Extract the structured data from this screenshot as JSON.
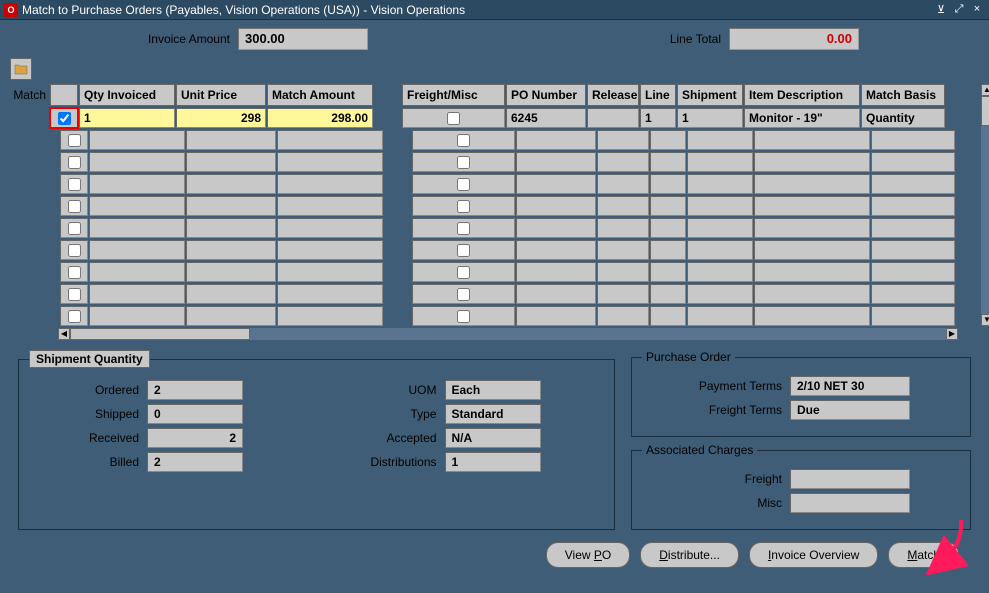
{
  "window": {
    "title": "Match to Purchase Orders (Payables, Vision Operations (USA)) - Vision Operations"
  },
  "header": {
    "invoice_amount_label": "Invoice Amount",
    "invoice_amount": "300.00",
    "line_total_label": "Line Total",
    "line_total": "0.00"
  },
  "grid": {
    "match_label": "Match",
    "columns": {
      "qty": "Qty Invoiced",
      "price": "Unit Price",
      "amt": "Match Amount",
      "fm": "Freight/Misc",
      "pon": "PO Number",
      "rel": "Release",
      "line": "Line",
      "ship": "Shipment",
      "desc": "Item Description",
      "basis": "Match Basis"
    },
    "rows": [
      {
        "checked": true,
        "qty": "1",
        "price": "298",
        "amt": "298.00",
        "fm": false,
        "pon": "6245",
        "rel": "",
        "line": "1",
        "ship": "1",
        "desc": "Monitor - 19\"",
        "basis": "Quantity",
        "active": true
      },
      {
        "checked": false,
        "qty": "",
        "price": "",
        "amt": "",
        "fm": false,
        "pon": "",
        "rel": "",
        "line": "",
        "ship": "",
        "desc": "",
        "basis": ""
      },
      {
        "checked": false,
        "qty": "",
        "price": "",
        "amt": "",
        "fm": false,
        "pon": "",
        "rel": "",
        "line": "",
        "ship": "",
        "desc": "",
        "basis": ""
      },
      {
        "checked": false,
        "qty": "",
        "price": "",
        "amt": "",
        "fm": false,
        "pon": "",
        "rel": "",
        "line": "",
        "ship": "",
        "desc": "",
        "basis": ""
      },
      {
        "checked": false,
        "qty": "",
        "price": "",
        "amt": "",
        "fm": false,
        "pon": "",
        "rel": "",
        "line": "",
        "ship": "",
        "desc": "",
        "basis": ""
      },
      {
        "checked": false,
        "qty": "",
        "price": "",
        "amt": "",
        "fm": false,
        "pon": "",
        "rel": "",
        "line": "",
        "ship": "",
        "desc": "",
        "basis": ""
      },
      {
        "checked": false,
        "qty": "",
        "price": "",
        "amt": "",
        "fm": false,
        "pon": "",
        "rel": "",
        "line": "",
        "ship": "",
        "desc": "",
        "basis": ""
      },
      {
        "checked": false,
        "qty": "",
        "price": "",
        "amt": "",
        "fm": false,
        "pon": "",
        "rel": "",
        "line": "",
        "ship": "",
        "desc": "",
        "basis": ""
      },
      {
        "checked": false,
        "qty": "",
        "price": "",
        "amt": "",
        "fm": false,
        "pon": "",
        "rel": "",
        "line": "",
        "ship": "",
        "desc": "",
        "basis": ""
      },
      {
        "checked": false,
        "qty": "",
        "price": "",
        "amt": "",
        "fm": false,
        "pon": "",
        "rel": "",
        "line": "",
        "ship": "",
        "desc": "",
        "basis": ""
      }
    ]
  },
  "shipment": {
    "legend": "Shipment Quantity",
    "ordered_label": "Ordered",
    "ordered": "2",
    "shipped_label": "Shipped",
    "shipped": "0",
    "received_label": "Received",
    "received": "2",
    "billed_label": "Billed",
    "billed": "2",
    "uom_label": "UOM",
    "uom": "Each",
    "type_label": "Type",
    "type": "Standard",
    "accepted_label": "Accepted",
    "accepted": "N/A",
    "dist_label": "Distributions",
    "dist": "1"
  },
  "po": {
    "legend": "Purchase Order",
    "terms_label": "Payment Terms",
    "terms": "2/10 NET 30",
    "freight_terms_label": "Freight Terms",
    "freight_terms": "Due",
    "assoc_legend": "Associated Charges",
    "freight_label": "Freight",
    "freight": "",
    "misc_label": "Misc",
    "misc": ""
  },
  "buttons": {
    "view_po": "View PO",
    "distribute": "Distribute...",
    "invoice_overview": "Invoice Overview",
    "match": "Match"
  }
}
